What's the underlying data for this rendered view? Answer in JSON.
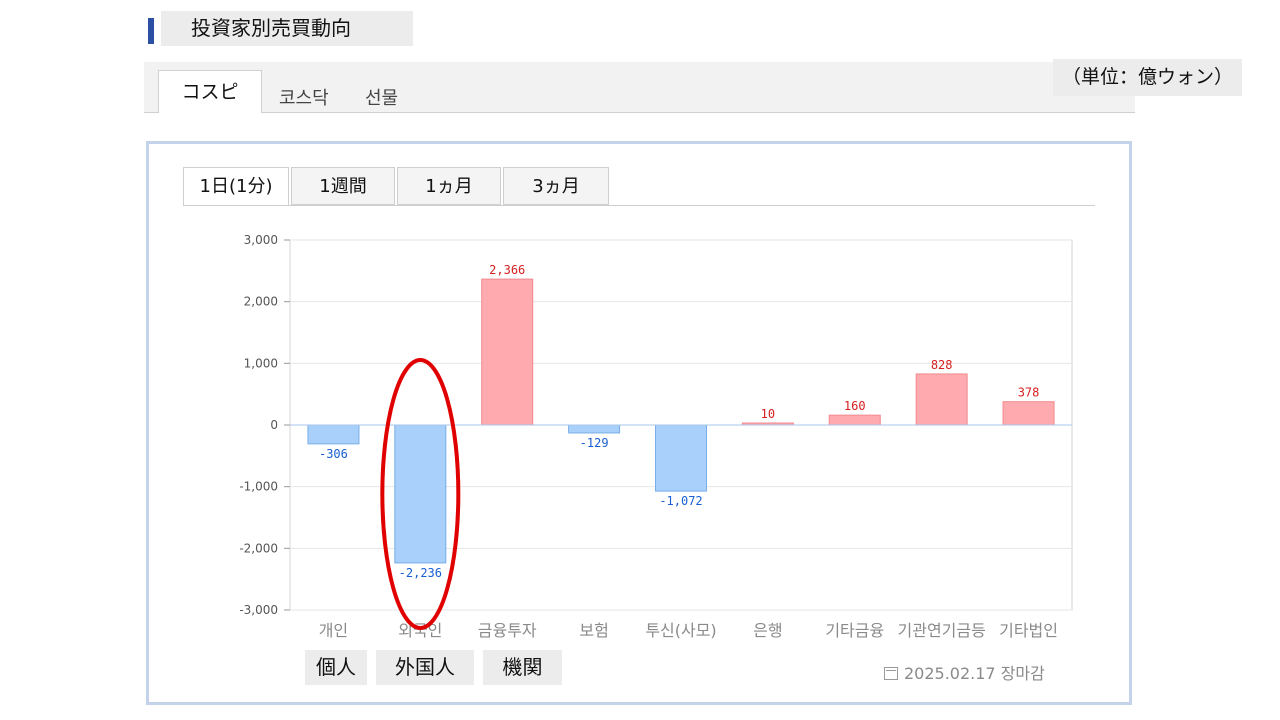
{
  "page": {
    "title": "投資家別売買動向",
    "unit": "（単位：億ウォン）"
  },
  "market_tabs": [
    {
      "label": "コスピ",
      "active": true
    },
    {
      "label": "코스닥",
      "active": false
    },
    {
      "label": "선물",
      "active": false
    }
  ],
  "period_tabs": [
    {
      "label": "1日(1分)",
      "active": true
    },
    {
      "label": "1週間",
      "active": false
    },
    {
      "label": "1ヵ月",
      "active": false
    },
    {
      "label": "3ヵ月",
      "active": false
    }
  ],
  "overlay_labels": [
    "個人",
    "外国人",
    "機関"
  ],
  "date_stamp": "2025.02.17 장마감",
  "colors": {
    "positive_fill": "#ffaaae",
    "positive_stroke": "#f08a90",
    "negative_fill": "#a8d0fb",
    "negative_stroke": "#79aee8",
    "positive_label": "#d62020",
    "negative_label": "#1a5fd0",
    "highlight_ring": "#e00000"
  },
  "chart_data": {
    "type": "bar",
    "categories": [
      "개인",
      "외국인",
      "금융투자",
      "보험",
      "투신(사모)",
      "은행",
      "기타금융",
      "기관연기금등",
      "기타법인"
    ],
    "values": [
      -306,
      -2236,
      2366,
      -129,
      -1072,
      10,
      160,
      828,
      378
    ],
    "data_labels": [
      "-306",
      "-2,236",
      "2,366",
      "-129",
      "-1,072",
      "10",
      "160",
      "828",
      "378"
    ],
    "y_ticks": [
      "3,000",
      "2,000",
      "1,000",
      "0",
      "-1,000",
      "-2,000",
      "-3,000"
    ],
    "ylim": [
      -3000,
      3000
    ],
    "grid": true,
    "highlighted_category": "외국인"
  }
}
